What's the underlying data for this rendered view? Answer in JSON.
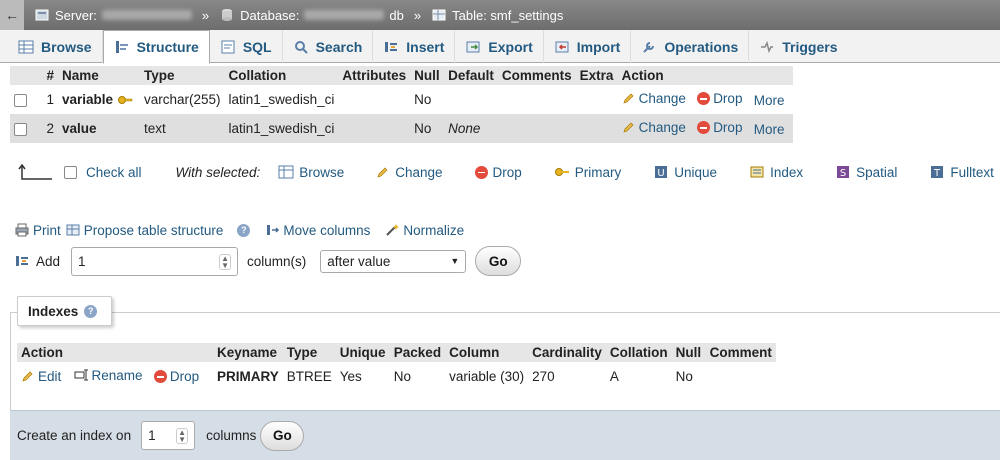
{
  "breadcrumb": {
    "back": "←",
    "server_label": "Server:",
    "sep1": "»",
    "database_label": "Database:",
    "database_suffix": "db",
    "sep2": "»",
    "table_label": "Table: smf_settings"
  },
  "tabs": [
    {
      "label": "Browse",
      "icon": "browse-icon"
    },
    {
      "label": "Structure",
      "icon": "structure-icon",
      "active": true
    },
    {
      "label": "SQL",
      "icon": "sql-icon"
    },
    {
      "label": "Search",
      "icon": "search-icon"
    },
    {
      "label": "Insert",
      "icon": "insert-icon"
    },
    {
      "label": "Export",
      "icon": "export-icon"
    },
    {
      "label": "Import",
      "icon": "import-icon"
    },
    {
      "label": "Operations",
      "icon": "wrench-icon"
    },
    {
      "label": "Triggers",
      "icon": "triggers-icon"
    }
  ],
  "structure": {
    "headers": [
      "#",
      "Name",
      "Type",
      "Collation",
      "Attributes",
      "Null",
      "Default",
      "Comments",
      "Extra",
      "Action"
    ],
    "rows": [
      {
        "num": "1",
        "name": "variable",
        "primary_key": true,
        "type": "varchar(255)",
        "collation": "latin1_swedish_ci",
        "attributes": "",
        "null": "No",
        "default": "",
        "comments": "",
        "extra": "",
        "change": "Change",
        "drop": "Drop",
        "more": "More"
      },
      {
        "num": "2",
        "name": "value",
        "primary_key": false,
        "type": "text",
        "collation": "latin1_swedish_ci",
        "attributes": "",
        "null": "No",
        "default": "None",
        "comments": "",
        "extra": "",
        "change": "Change",
        "drop": "Drop",
        "more": "More"
      }
    ]
  },
  "with_selected": {
    "check_all": "Check all",
    "label": "With selected:",
    "actions": [
      "Browse",
      "Change",
      "Drop",
      "Primary",
      "Unique",
      "Index",
      "Spatial",
      "Fulltext"
    ]
  },
  "tools": {
    "print": "Print",
    "propose": "Propose table structure",
    "move_columns": "Move columns",
    "normalize": "Normalize"
  },
  "add_columns": {
    "label": "Add",
    "value": "1",
    "unit": "column(s)",
    "position": "after value",
    "go": "Go"
  },
  "indexes": {
    "title": "Indexes",
    "headers": [
      "Action",
      "Keyname",
      "Type",
      "Unique",
      "Packed",
      "Column",
      "Cardinality",
      "Collation",
      "Null",
      "Comment"
    ],
    "rows": [
      {
        "edit": "Edit",
        "rename": "Rename",
        "drop": "Drop",
        "keyname": "PRIMARY",
        "type": "BTREE",
        "unique": "Yes",
        "packed": "No",
        "column": "variable (30)",
        "cardinality": "270",
        "collation": "A",
        "null": "No",
        "comment": ""
      }
    ]
  },
  "create_index": {
    "label": "Create an index on",
    "value": "1",
    "unit": "columns",
    "go": "Go"
  },
  "colors": {
    "link": "#235a81",
    "drop": "#e24a3b",
    "topbar": "#777777",
    "footer": "#d5dde6"
  }
}
